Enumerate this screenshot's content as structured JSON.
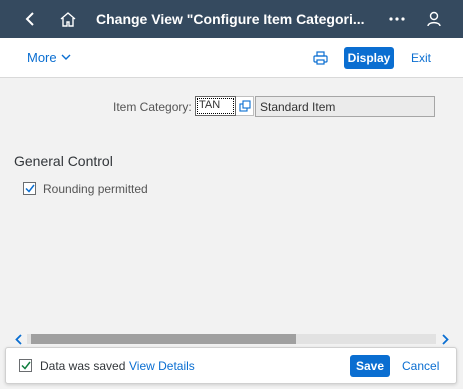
{
  "shell": {
    "title": "Change View \"Configure Item Categori...",
    "icons": [
      "back-icon",
      "home-icon",
      "overflow-icon",
      "user-icon"
    ],
    "bg_color": "#354a5f"
  },
  "toolbar": {
    "more_label": "More",
    "display_label": "Display",
    "exit_label": "Exit",
    "accent_color": "#0a6ed1"
  },
  "form": {
    "item_category_label": "Item Category:",
    "item_category_value": "TAN",
    "item_category_description": "Standard Item"
  },
  "general_control": {
    "title": "General Control",
    "rounding_label": "Rounding permitted",
    "rounding_checked": true
  },
  "footer": {
    "message": "Data was saved",
    "view_details_label": "View Details",
    "save_label": "Save",
    "cancel_label": "Cancel"
  }
}
